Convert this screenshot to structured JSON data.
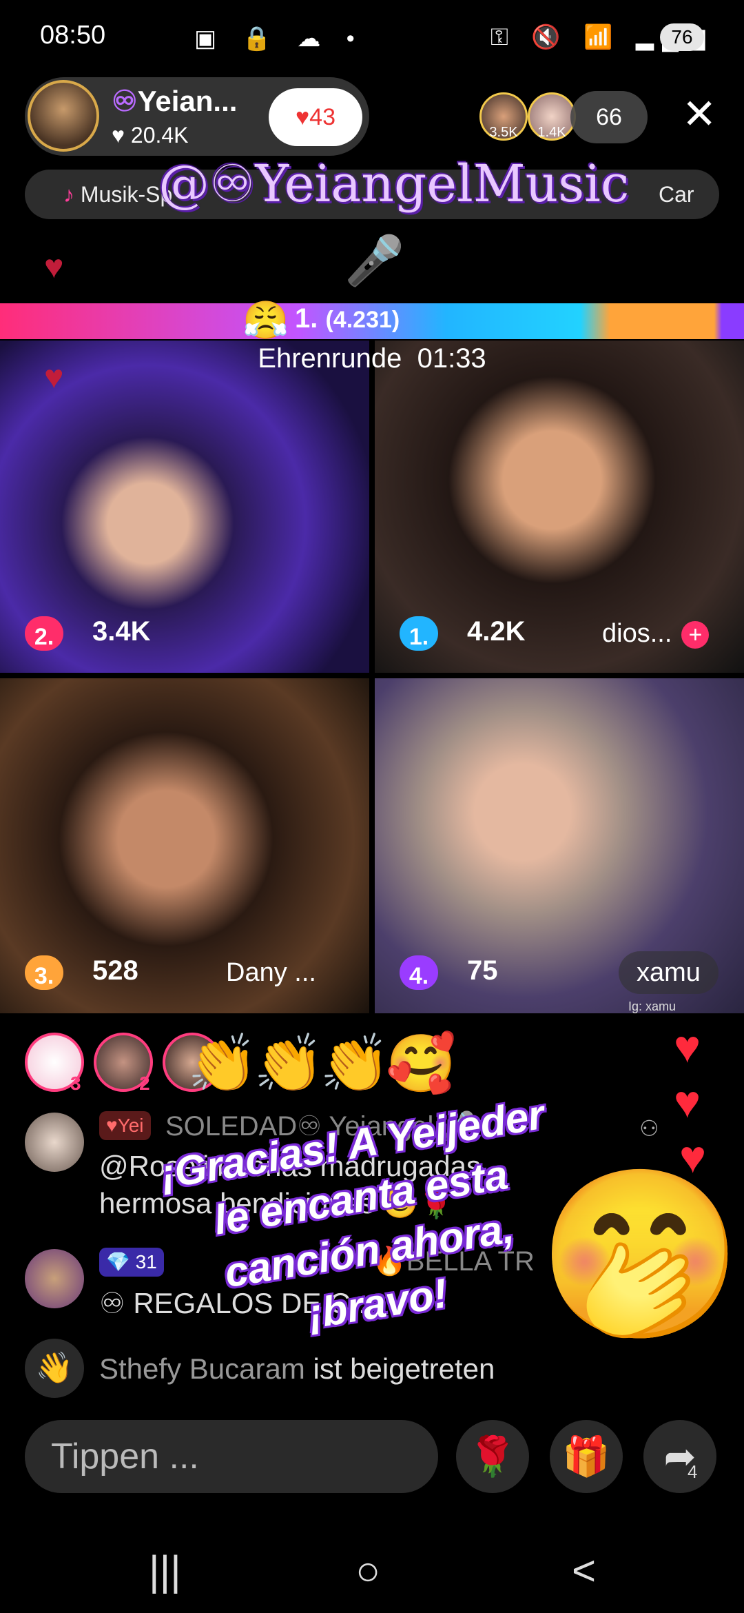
{
  "status_bar": {
    "time": "08:50",
    "left_icons": "▣ 🔒 ☁ •",
    "right_icons": "⚿ 🔇 📶 ▂▄▆",
    "battery": "76"
  },
  "host": {
    "name": "Yeian...",
    "inf_symbol": "♾",
    "likes": "♥ 20.4K",
    "follow_count": "43",
    "follow_icon": "heart-icon"
  },
  "viewers": {
    "top1": "3.5K",
    "top2": "1.4K",
    "count": "66"
  },
  "close_icon": "✕",
  "banner": {
    "left": "Musik-Sp",
    "right": "Car"
  },
  "handle_overlay": "@♾YeiangelMusic",
  "battle": {
    "leader_rank": "1.",
    "leader_score": "(4.231)",
    "emoji": "😤",
    "timer_label": "Ehrenrunde",
    "timer_value": "01:33"
  },
  "tiles": [
    {
      "rank": "2.",
      "score": "3.4K",
      "name": "",
      "rank_color": "#ff2d6a"
    },
    {
      "rank": "1.",
      "score": "4.2K",
      "name": "dios...",
      "rank_color": "#22b5ff"
    },
    {
      "rank": "3.",
      "score": "528",
      "name": "Dany ...",
      "rank_color": "#ffa43a"
    },
    {
      "rank": "4.",
      "score": "75",
      "name": "xamu",
      "rank_color": "#9a3cff"
    }
  ],
  "tile4_watermark": "Ig: xamu",
  "top_gifters": [
    {
      "count": "3"
    },
    {
      "count": "2"
    },
    {
      "count": ""
    }
  ],
  "reaction_emojis": "👏👏👏🥰",
  "chat": [
    {
      "badge": "Yei",
      "user": "SOLEDAD♾ Yeiangel 🎤",
      "message_line1": "@Roseli buenas madrugadas",
      "message_line2": "hermosa bendiciones 😊🌹"
    },
    {
      "badge": "31",
      "user": "🔥BELLA TR",
      "message_line1": "♾ REGALOS DE C...",
      "message_line2": ""
    }
  ],
  "join_message": {
    "user": "Sthefy Bucaram",
    "text": "ist beigetreten"
  },
  "overlay_text": "¡Gracias! A Yeijeder le encanta esta canción ahora, ¡bravo!",
  "overlay_emoji": "🤭",
  "bottom_bar": {
    "input_placeholder": "Tippen ...",
    "rose": "🌹",
    "gift": "🎁",
    "share_count": "4"
  },
  "nav": {
    "recents": "|||",
    "home": "○",
    "back": "<"
  }
}
